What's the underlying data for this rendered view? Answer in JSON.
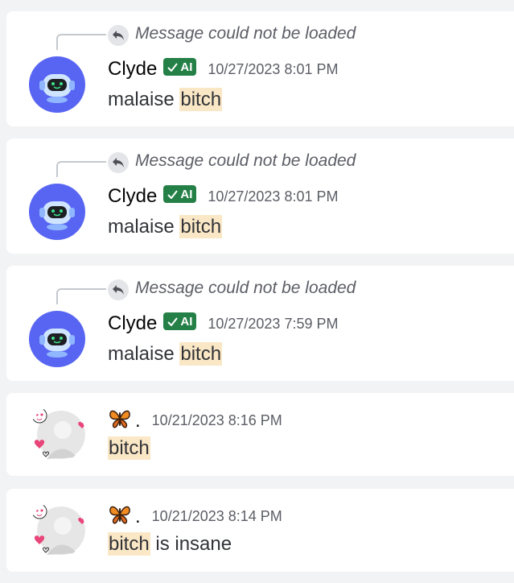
{
  "colors": {
    "page_background": "#f2f3f5",
    "card_background": "#ffffff",
    "bot_avatar": "#5865f2",
    "ai_badge": "#248046",
    "highlight": "#fae7c5"
  },
  "messages": [
    {
      "reply_text": "Message could not be loaded",
      "author": "Clyde",
      "badge": "AI",
      "timestamp": "10/27/2023 8:01 PM",
      "content_pre": "malaise ",
      "content_hl": "bitch",
      "content_post": ""
    },
    {
      "reply_text": "Message could not be loaded",
      "author": "Clyde",
      "badge": "AI",
      "timestamp": "10/27/2023 8:01 PM",
      "content_pre": "malaise ",
      "content_hl": "bitch",
      "content_post": ""
    },
    {
      "reply_text": "Message could not be loaded",
      "author": "Clyde",
      "badge": "AI",
      "timestamp": "10/27/2023 7:59 PM",
      "content_pre": "malaise ",
      "content_hl": "bitch",
      "content_post": ""
    },
    {
      "author_icon": "butterfly-emoji",
      "author_suffix": ".",
      "timestamp": "10/21/2023 8:16 PM",
      "content_pre": "",
      "content_hl": "bitch",
      "content_post": ""
    },
    {
      "author_icon": "butterfly-emoji",
      "author_suffix": ".",
      "timestamp": "10/21/2023 8:14 PM",
      "content_pre": "",
      "content_hl": "bitch",
      "content_post": " is insane"
    }
  ]
}
